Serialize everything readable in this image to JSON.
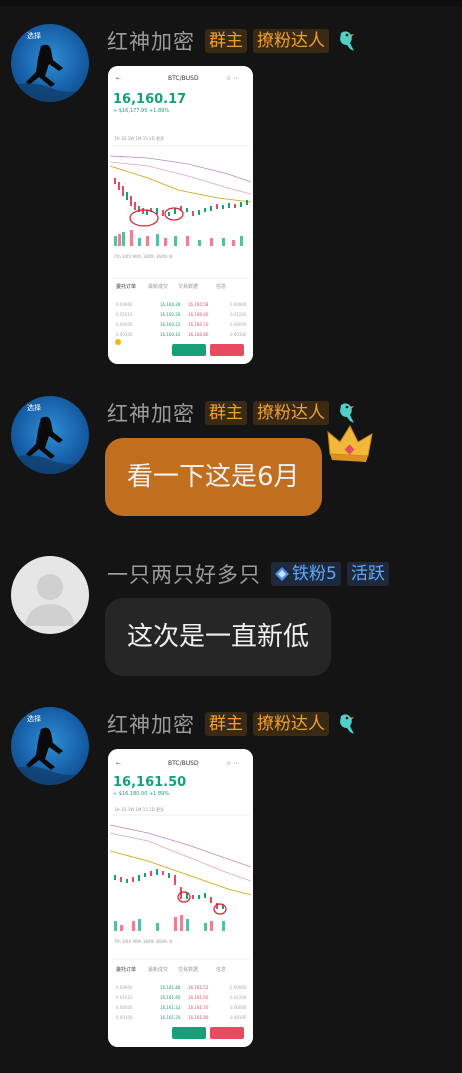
{
  "messages": [
    {
      "sender": "红神加密",
      "tags": [
        "群主",
        "撩粉达人"
      ],
      "type": "image",
      "screenshot": {
        "pair": "BTC/BUSD",
        "price": "16,160.17",
        "change": "≈ $16,177.95  +1.89%"
      }
    },
    {
      "sender": "红神加密",
      "tags": [
        "群主",
        "撩粉达人"
      ],
      "type": "text",
      "text": "看一下这是6月"
    },
    {
      "sender": "一只两只好多只",
      "tags": [
        "铁粉5",
        "活跃"
      ],
      "type": "text",
      "text": "这次是一直新低"
    },
    {
      "sender": "红神加密",
      "tags": [
        "群主",
        "撩粉达人"
      ],
      "type": "image",
      "screenshot": {
        "pair": "BTC/BUSD",
        "price": "16,161.50",
        "change": "≈ $16,180.00  +1.89%"
      }
    }
  ],
  "colors": {
    "background": "#141414",
    "bubble_orange": "#c16f1e",
    "bubble_dark": "#262626",
    "tag_gold": "#f0a030",
    "tag_blue": "#5ea8ff",
    "price_green": "#16a07a",
    "sell_red": "#e84a5f"
  }
}
